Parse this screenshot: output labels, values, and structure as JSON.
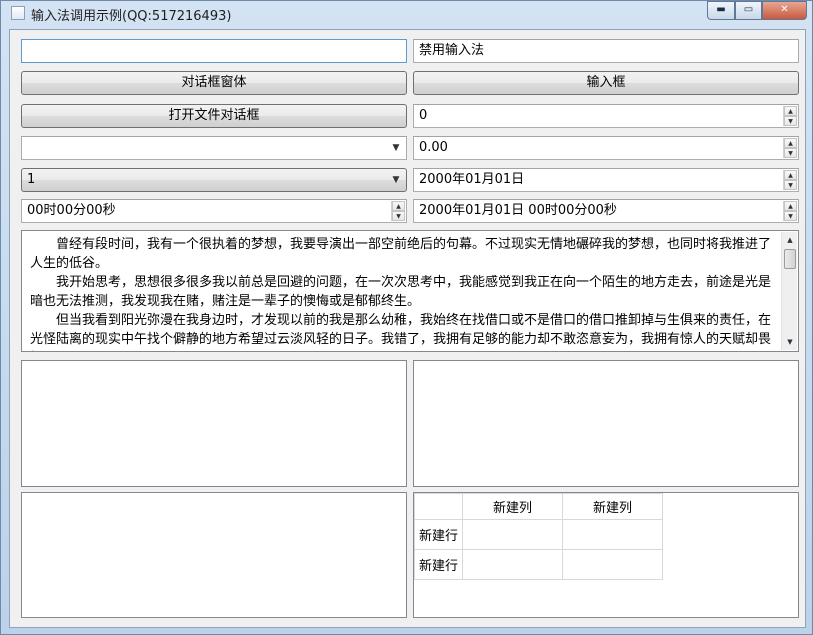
{
  "window": {
    "title": "输入法调用示例(QQ:517216493)",
    "min_glyph": "▬",
    "max_glyph": "▭",
    "close_glyph": "✕"
  },
  "row1": {
    "line_edit_value": "",
    "disabled_input_value": "禁用输入法"
  },
  "row2": {
    "dialog_button": "对话框窗体",
    "input_button": "输入框"
  },
  "row3": {
    "file_dialog_button": "打开文件对话框",
    "spin_value": "0"
  },
  "row4": {
    "combo_value": "",
    "double_spin_value": "0.00"
  },
  "row5": {
    "combo_value": "1",
    "date_value": "2000年01月01日"
  },
  "row6": {
    "time_value": "00时00分00秒",
    "datetime_value": "2000年01月01日 00时00分00秒"
  },
  "text_area": {
    "paragraphs": [
      "曾经有段时间，我有一个很执着的梦想，我要导演出一部空前绝后的句幕。不过现实无情地碾碎我的梦想，也同时将我推进了人生的低谷。",
      "我开始思考，思想很多很多我以前总是回避的问题，在一次次思考中，我能感觉到我正在向一个陌生的地方走去，前途是光是暗也无法推测，我发现我在赌，赌注是一辈子的懊悔或是郁郁终生。",
      "但当我看到阳光弥漫在我身边时，才发现以前的我是那么幼稚，我始终在找借口或不是借口的借口推卸掉与生俱来的责任，在光怪陆离的现实中午找个僻静的地方希望过云淡风轻的日子。我错了，我拥有足够的能力却不敢恣意妄为，我拥有惊人的天赋却畏惧"
    ]
  },
  "table": {
    "columns": [
      "新建列",
      "新建列"
    ],
    "rows": [
      "新建行",
      "新建行"
    ]
  },
  "icons": {
    "spin_up": "▲",
    "spin_down": "▼",
    "combo_arrow": "▼",
    "scroll_up": "▲",
    "scroll_down": "▼"
  }
}
